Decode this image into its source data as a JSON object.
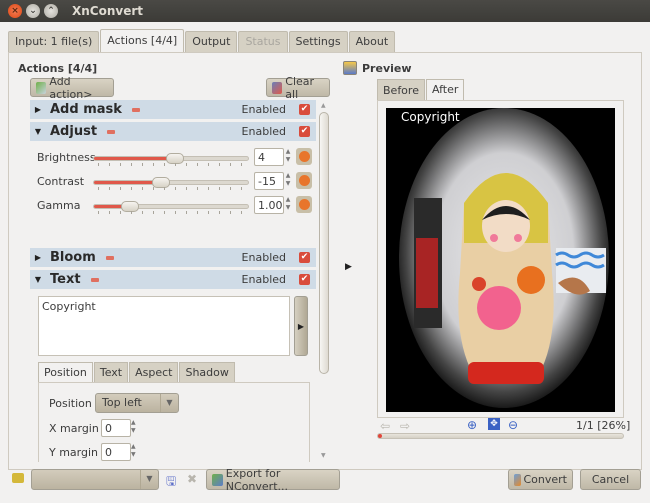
{
  "window": {
    "title": "XnConvert"
  },
  "tabs": [
    {
      "label": "Input: 1 file(s)",
      "state": "normal"
    },
    {
      "label": "Actions [4/4]",
      "state": "active"
    },
    {
      "label": "Output",
      "state": "normal"
    },
    {
      "label": "Status",
      "state": "disabled"
    },
    {
      "label": "Settings",
      "state": "normal"
    },
    {
      "label": "About",
      "state": "normal"
    }
  ],
  "actions": {
    "title": "Actions [4/4]",
    "add_action_label": "Add action>",
    "clear_all_label": "Clear all",
    "enabled_label": "Enabled",
    "items": [
      {
        "name": "Add mask",
        "expanded": false,
        "enabled": true
      },
      {
        "name": "Adjust",
        "expanded": true,
        "enabled": true
      },
      {
        "name": "Bloom",
        "expanded": false,
        "enabled": true
      },
      {
        "name": "Text",
        "expanded": true,
        "enabled": true
      }
    ],
    "adjust": {
      "sliders": [
        {
          "label": "Brightness",
          "value": "4",
          "fraction": 0.52
        },
        {
          "label": "Contrast",
          "value": "-15",
          "fraction": 0.43
        },
        {
          "label": "Gamma",
          "value": "1.00",
          "fraction": 0.23
        }
      ]
    },
    "text": {
      "content": "Copyright",
      "subtabs": [
        "Position",
        "Text",
        "Aspect",
        "Shadow"
      ],
      "active_subtab": "Position",
      "position_label": "Position",
      "position_value": "Top left",
      "x_margin_label": "X margin",
      "x_margin_value": "0",
      "y_margin_label": "Y margin",
      "y_margin_value": "0"
    }
  },
  "preview": {
    "title": "Preview",
    "tabs": [
      "Before",
      "After"
    ],
    "active_tab": "After",
    "overlay_text": "Copyright",
    "page_info": "1/1 [26%]",
    "progress": 0.01
  },
  "bottom": {
    "preset_value": "",
    "export_label": "Export for NConvert...",
    "convert_label": "Convert",
    "cancel_label": "Cancel"
  }
}
